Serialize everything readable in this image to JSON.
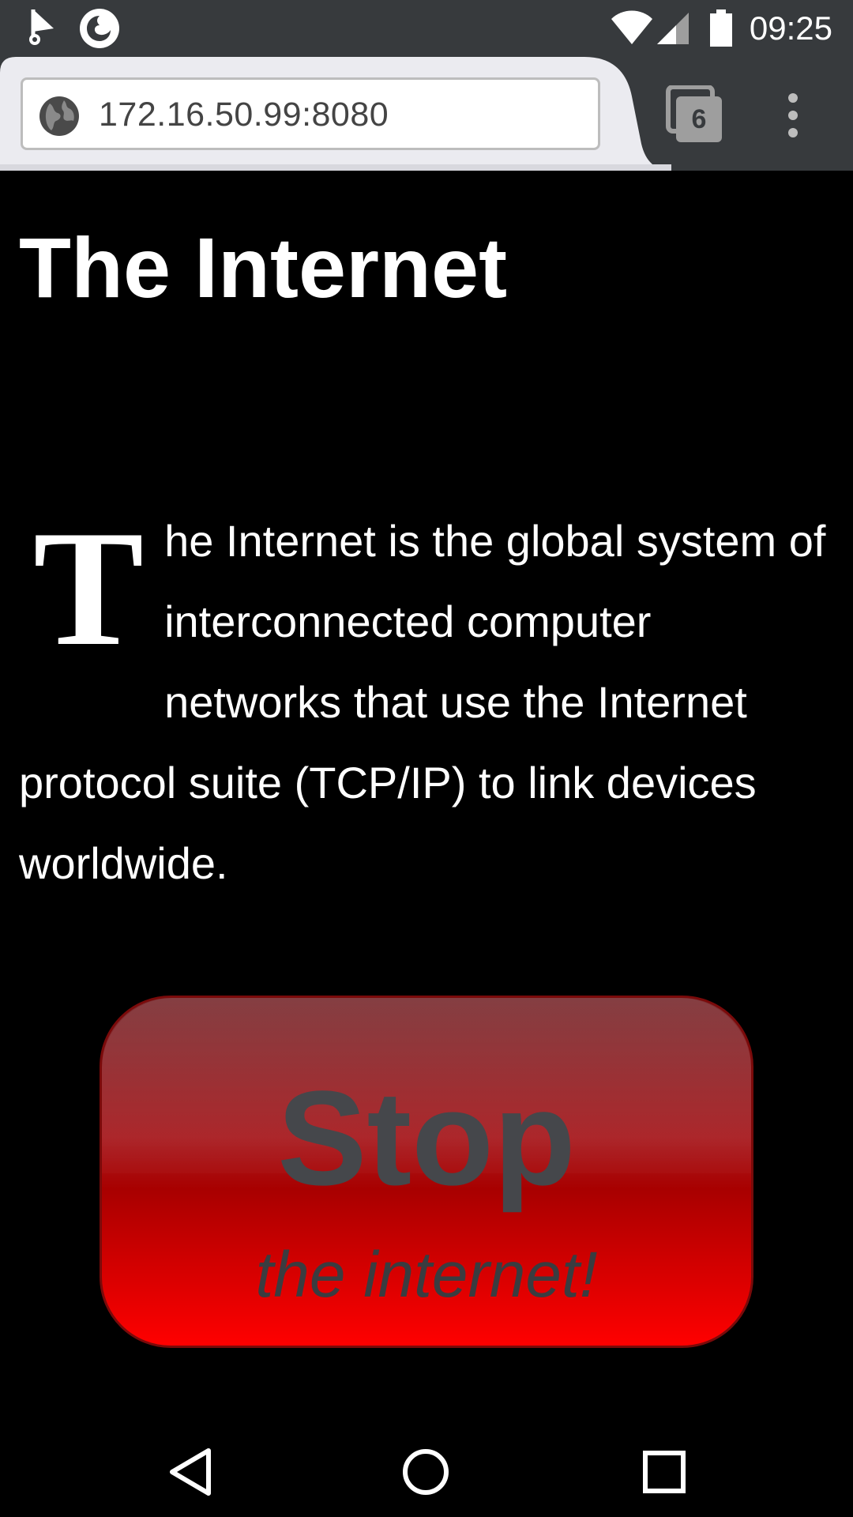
{
  "status_bar": {
    "time": "09:25",
    "left_icons": [
      "location-flag-icon",
      "firefox-icon"
    ],
    "right_icons": [
      "wifi-icon",
      "cell-signal-icon",
      "battery-icon"
    ]
  },
  "browser": {
    "url": "172.16.50.99:8080",
    "tab_count": "6",
    "icons": [
      "globe-icon",
      "tabs-icon",
      "overflow-menu-icon"
    ]
  },
  "page": {
    "heading": "The Internet",
    "drop_cap": "T",
    "paragraph": "he Internet is the global system of interconnected computer networks that use the Internet protocol suite (TCP/IP) to link devices worldwide.",
    "button": {
      "title": "Stop",
      "subtitle": "the internet!"
    }
  },
  "nav_bar": {
    "icons": [
      "back-icon",
      "home-icon",
      "recents-icon"
    ]
  },
  "colors": {
    "status_bar_bg": "#373a3d",
    "page_bg": "#000000",
    "button_red": "#ff0000"
  }
}
